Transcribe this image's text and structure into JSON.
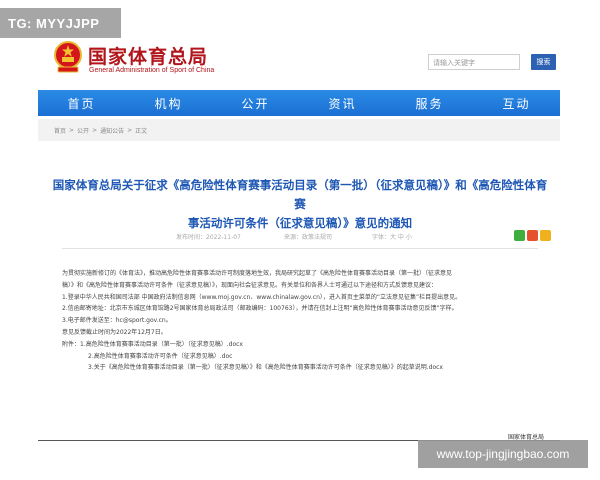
{
  "watermarks": {
    "top": "TG: MYYJJPP",
    "bottom": "www.top-jingjingbao.com"
  },
  "header": {
    "org_name_cn": "国家体育总局",
    "org_name_en": "General Administration of Sport of China",
    "search_placeholder": "请输入关键字",
    "search_button": "搜索"
  },
  "nav": {
    "items": [
      "首页",
      "机构",
      "公开",
      "资讯",
      "服务",
      "互动"
    ]
  },
  "breadcrumb": [
    "首页",
    "公开",
    "通知公告",
    "正文"
  ],
  "article": {
    "title_line1": "国家体育总局关于征求《高危险性体育赛事活动目录（第一批）（征求意见稿）》和《高危险性体育赛",
    "title_line2": "事活动许可条件（征求意见稿）》意见的通知",
    "publish_date": "发布时间：2022-11-07",
    "source": "来源：政策法规司",
    "font_size": "字体：大 中 小",
    "paragraphs": [
      "为贯彻实施新修订的《体育法》，推动高危险性体育赛事活动许可制度落地生效，我局研究起草了《高危险性体育赛事活动目录（第一批）（征求意见",
      "稿）》和《高危险性体育赛事活动许可条件（征求意见稿）》，现面向社会征求意见。有关单位和各界人士可通过以下途径和方式反馈意见建议：",
      "1.登录中华人民共和国司法部 中国政府法制信息网（www.moj.gov.cn、www.chinalaw.gov.cn），进入首页主菜单的“立法意见征集”栏目提出意见。",
      "2.信函邮寄地址：北京市东城区体育馆路2号国家体育总局政法司（邮政编码：100763），并请在信封上注明“高危险性体育赛事活动意见反馈”字样。",
      "3.电子邮件发送至：hc@sport.gov.cn。",
      "意见反馈截止时间为2022年12月7日。"
    ],
    "attachments_label": "附件：",
    "attachments": [
      "1.高危险性体育赛事活动目录（第一批）（征求意见稿）.docx",
      "2.高危险性体育赛事活动许可条件（征求意见稿）.doc",
      "3.关于《高危险性体育赛事活动目录（第一批）（征求意见稿）》和《高危险性体育赛事活动许可条件（征求意见稿）》的起草说明.docx"
    ],
    "signature": "国家体育总局"
  },
  "colors": {
    "brand_red": "#b2141b",
    "nav_blue": "#1c6fd3",
    "title_blue": "#1e57b4"
  },
  "icons": {
    "emblem": "national-emblem-icon",
    "share": [
      "wechat-icon",
      "weibo-icon",
      "qzone-icon"
    ]
  }
}
